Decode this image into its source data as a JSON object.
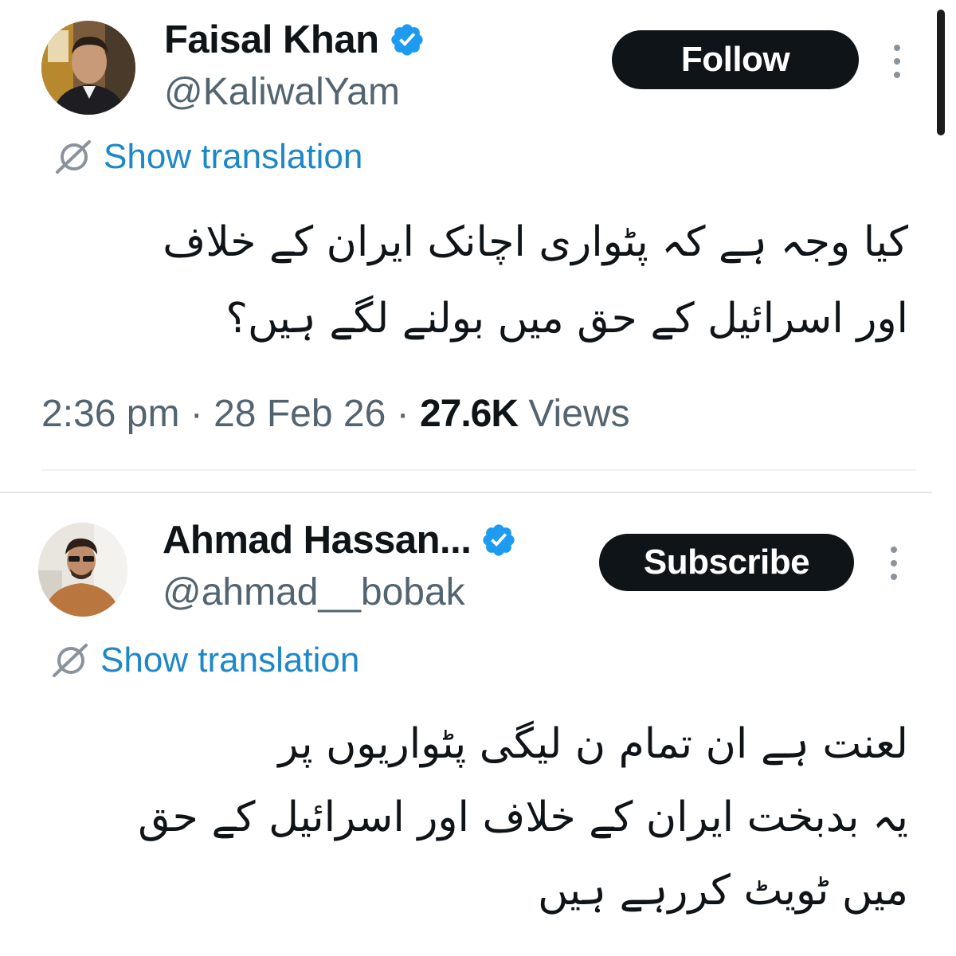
{
  "tweets": [
    {
      "author_name": "Faisal Khan",
      "handle": "@KaliwalYam",
      "verified": true,
      "action_label": "Follow",
      "translate_label": "Show translation",
      "body_lines": [
        "کیا وجہ ہے کہ پٹواری اچانک ایران کے خلاف",
        "اور اسرائیل کے حق میں بولنے لگے ہیں؟"
      ],
      "time": "2:36 pm",
      "date": "28 Feb 26",
      "views_count": "27.6K",
      "views_label": "Views"
    },
    {
      "author_name": "Ahmad Hassan...",
      "handle": "@ahmad__bobak",
      "verified": true,
      "action_label": "Subscribe",
      "translate_label": "Show translation",
      "body_lines": [
        "لعنت ہے ان تمام ن لیگی پٹواریوں پر",
        "یہ بدبخت ایران کے خلاف اور اسرائیل کے حق",
        "میں ٹویٹ کررہے ہیں"
      ]
    }
  ],
  "meta_separator": "·",
  "colors": {
    "verified_badge": "#1d9bf0",
    "link": "#1d88c8",
    "button_bg": "#0f1419",
    "secondary_text": "#536471"
  },
  "icons": {
    "verified": "verified-badge-icon",
    "translate": "translate-icon",
    "more": "more-vertical-icon"
  }
}
